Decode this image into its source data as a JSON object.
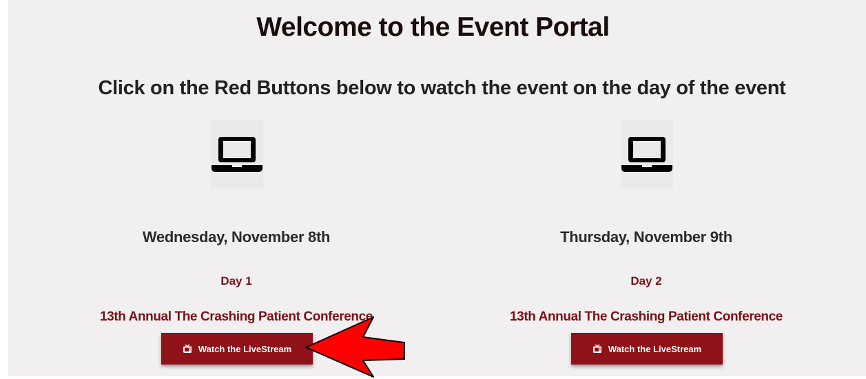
{
  "header": {
    "title": "Welcome to the Event Portal",
    "subtitle": "Click on the Red Buttons below to watch the event on the day of the event"
  },
  "days": [
    {
      "date": "Wednesday, November 8th",
      "day_label": "Day 1",
      "conference": "13th Annual The Crashing Patient Conference",
      "button_label": "Watch the LiveStream",
      "icon": "laptop-icon"
    },
    {
      "date": "Thursday, November 9th",
      "day_label": "Day 2",
      "conference": "13th Annual The Crashing Patient Conference",
      "button_label": "Watch the LiveStream",
      "icon": "laptop-icon"
    }
  ],
  "colors": {
    "accent": "#8e1217",
    "text_red": "#7c1014",
    "background": "#f1efef",
    "arrow": "#ff0000"
  }
}
